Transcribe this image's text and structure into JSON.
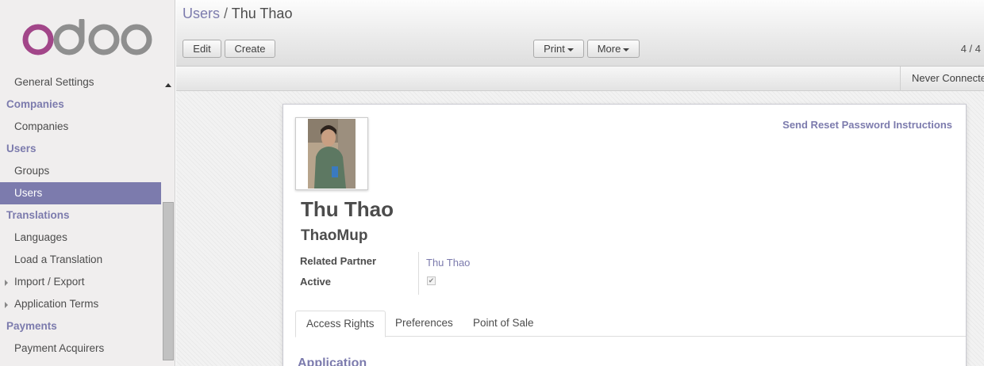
{
  "colors": {
    "accent": "#7c7bad",
    "text": "#4c4c4c"
  },
  "sidebar": {
    "items": [
      {
        "type": "item",
        "label": "General Settings"
      },
      {
        "type": "section",
        "label": "Companies"
      },
      {
        "type": "item",
        "label": "Companies"
      },
      {
        "type": "section",
        "label": "Users"
      },
      {
        "type": "item",
        "label": "Groups"
      },
      {
        "type": "item",
        "label": "Users",
        "active": true
      },
      {
        "type": "section",
        "label": "Translations"
      },
      {
        "type": "item",
        "label": "Languages"
      },
      {
        "type": "item",
        "label": "Load a Translation"
      },
      {
        "type": "item",
        "label": "Import / Export",
        "expandable": true
      },
      {
        "type": "item",
        "label": "Application Terms",
        "expandable": true
      },
      {
        "type": "section",
        "label": "Payments"
      },
      {
        "type": "item",
        "label": "Payment Acquirers"
      }
    ]
  },
  "header": {
    "breadcrumb_parent": "Users",
    "breadcrumb_separator": "/",
    "breadcrumb_current": "Thu Thao",
    "edit_label": "Edit",
    "create_label": "Create",
    "print_label": "Print",
    "more_label": "More",
    "pager": "4 / 4"
  },
  "statusbar": {
    "login_status": "Never Connected"
  },
  "form": {
    "reset_link": "Send Reset Password Instructions",
    "name": "Thu Thao",
    "login": "ThaoMup",
    "related_partner_label": "Related Partner",
    "related_partner_value": "Thu Thao",
    "active_label": "Active",
    "active_checked": true,
    "tabs": [
      "Access Rights",
      "Preferences",
      "Point of Sale"
    ],
    "section_title": "Application"
  }
}
